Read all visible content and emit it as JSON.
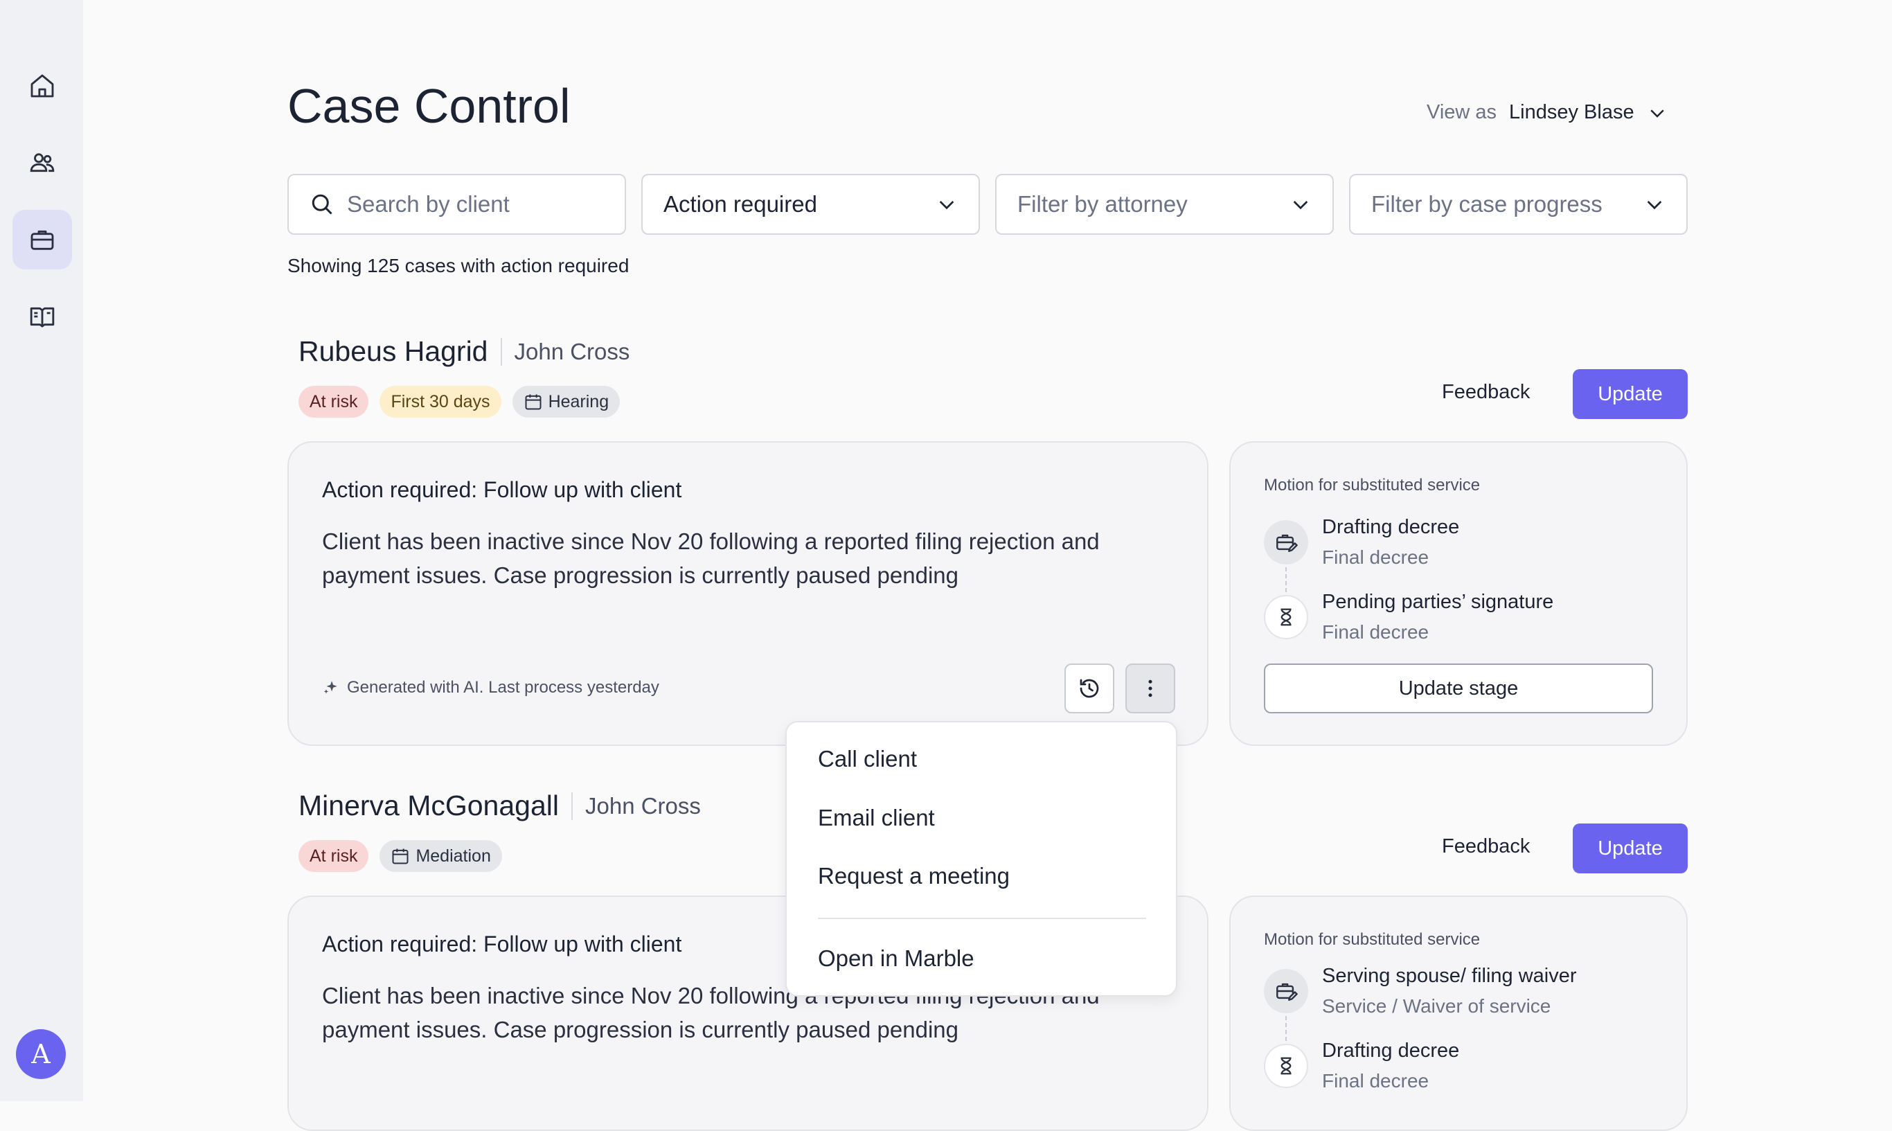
{
  "page": {
    "title": "Case Control"
  },
  "view_as": {
    "label": "View as",
    "name": "Lindsey Blase"
  },
  "filters": {
    "search_placeholder": "Search by client",
    "status_value": "Action required",
    "attorney_placeholder": "Filter by attorney",
    "progress_placeholder": "Filter by case progress"
  },
  "summary": "Showing 125 cases with action required",
  "avatar_initial": "A",
  "sidebar": {
    "items": [
      "home-icon",
      "people-icon",
      "briefcase-icon",
      "book-icon"
    ],
    "active": "briefcase-icon"
  },
  "cases": [
    {
      "client": "Rubeus Hagrid",
      "attorney": "John Cross",
      "tags": {
        "risk": "At risk",
        "period": "First 30 days",
        "event": "Hearing"
      },
      "feedback_label": "Feedback",
      "update_label": "Update",
      "action_title": "Action required: Follow up with client",
      "action_body": "Client has been inactive since Nov 20 following a reported filing rejection and payment issues. Case progression is currently paused pending",
      "ai_note": "Generated with AI. Last process yesterday",
      "motion": {
        "title": "Motion for substituted service",
        "steps": [
          {
            "title": "Drafting decree",
            "subtitle": "Final decree"
          },
          {
            "title": "Pending parties’ signature",
            "subtitle": "Final decree"
          }
        ],
        "button": "Update stage"
      }
    },
    {
      "client": "Minerva McGonagall",
      "attorney": "John Cross",
      "tags": {
        "risk": "At risk",
        "event": "Mediation"
      },
      "feedback_label": "Feedback",
      "update_label": "Update",
      "action_title": "Action required: Follow up with client",
      "action_body": "Client has been inactive since Nov 20 following a reported filing rejection and payment issues. Case progression is currently paused pending",
      "motion": {
        "title": "Motion for substituted service",
        "steps": [
          {
            "title": "Serving spouse/ filing waiver",
            "subtitle": "Service / Waiver of service"
          },
          {
            "title": "Drafting decree",
            "subtitle": "Final decree"
          }
        ]
      }
    }
  ],
  "context_menu": {
    "items": [
      "Call client",
      "Email client",
      "Request a meeting"
    ],
    "footer_item": "Open in Marble"
  },
  "colors": {
    "accent": "#6a63f0",
    "risk_bg": "#f9d7d7",
    "first_bg": "#fcefc9"
  }
}
